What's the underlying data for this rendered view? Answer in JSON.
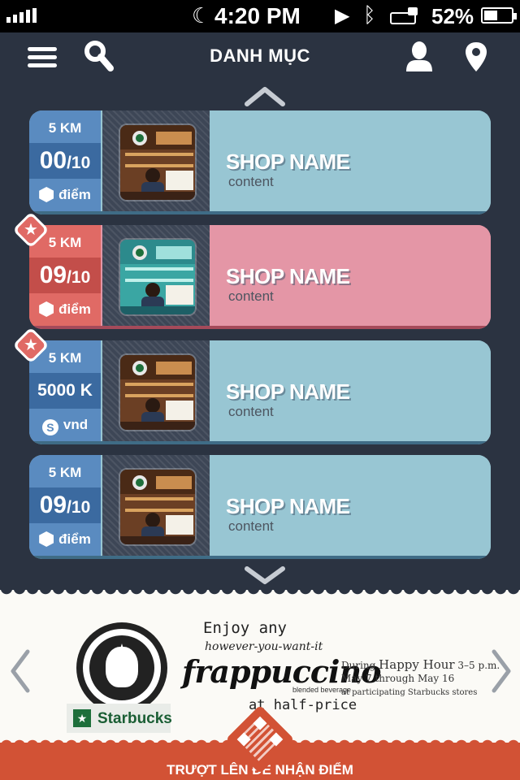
{
  "status_bar": {
    "time": "4:20 PM",
    "battery_percent": "52%",
    "battery_level": 0.52,
    "signal_bars": 5,
    "icons": [
      "signal-icon",
      "moon-icon",
      "play-icon",
      "bluetooth-icon",
      "lock-rotation-icon",
      "battery-icon"
    ]
  },
  "nav": {
    "title": "DANH MỤC",
    "icons": [
      "menu-icon",
      "search-icon",
      "user-icon",
      "location-pin-icon"
    ]
  },
  "colors": {
    "background": "#2b3341",
    "blue_stat": "#5a8bc0",
    "blue_stat_dark": "#3b6aa0",
    "red_stat": "#e06a65",
    "red_stat_dark": "#c34e4a",
    "blue_card": "#98c6d3",
    "pink_card": "#e496a6",
    "accent_orange": "#d25235"
  },
  "shops": [
    {
      "distance": "5 KM",
      "score": "00",
      "score_max": "/10",
      "unit": "điểm",
      "unit_icon": "hexagon-icon",
      "name": "SHOP NAME",
      "content": "content",
      "theme": "blue",
      "favorite": false
    },
    {
      "distance": "5 KM",
      "score": "09",
      "score_max": "/10",
      "unit": "điểm",
      "unit_icon": "hexagon-icon",
      "name": "SHOP NAME",
      "content": "content",
      "theme": "red",
      "favorite": true
    },
    {
      "distance": "5 KM",
      "score": "5000 K",
      "score_max": "",
      "unit": "vnd",
      "unit_icon": "coin-icon",
      "name": "SHOP NAME",
      "content": "content",
      "theme": "blue",
      "favorite": true
    },
    {
      "distance": "5 KM",
      "score": "09",
      "score_max": "/10",
      "unit": "điểm",
      "unit_icon": "hexagon-icon",
      "name": "SHOP NAME",
      "content": "content",
      "theme": "blue",
      "favorite": false
    }
  ],
  "ad": {
    "brand": "Starbucks",
    "enjoy": "Enjoy any",
    "however": "however-you-want-it",
    "product": "frappuccino",
    "blended": "blended beverage",
    "half_price": "at half-price",
    "during": "During",
    "happy_hour": "Happy Hour",
    "hours": "3–5 p.m.",
    "dates": "May 7 through May 16",
    "stores": "at participating Starbucks stores"
  },
  "bottom_bar": {
    "label": "TRƯỢT LÊN ĐỂ NHẬN ĐIỂM",
    "icon": "qr-code-icon"
  }
}
